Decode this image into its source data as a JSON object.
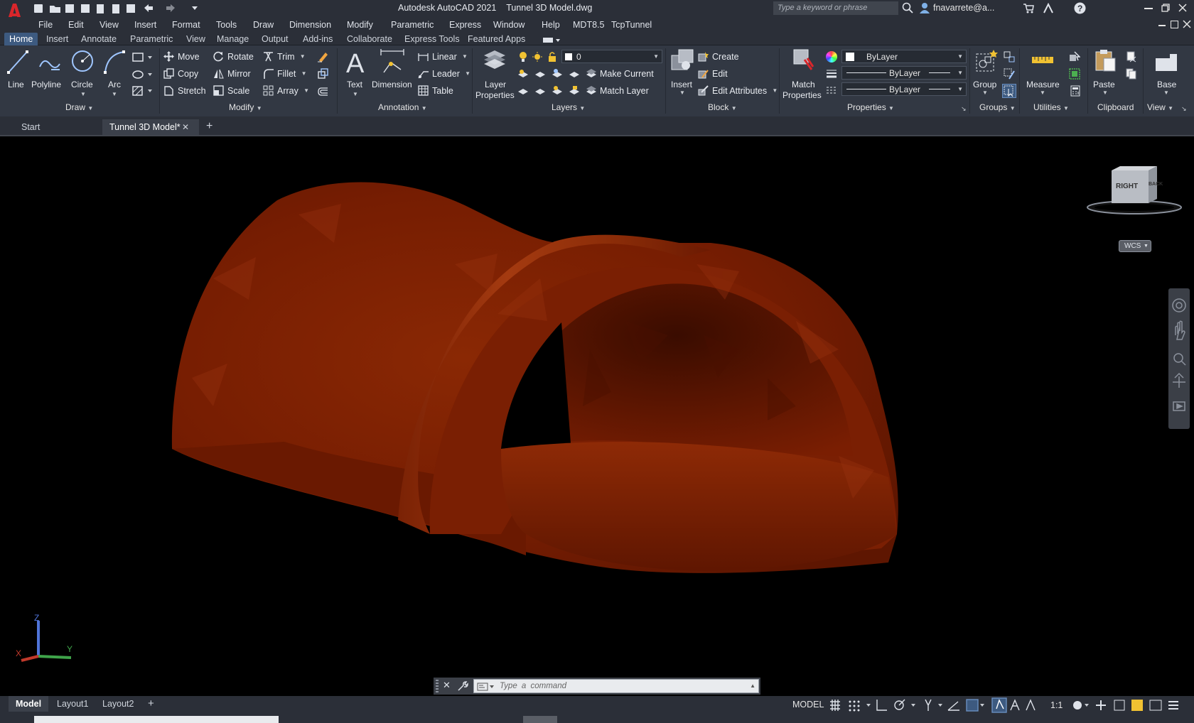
{
  "title": {
    "app": "Autodesk AutoCAD 2021",
    "file": "Tunnel 3D Model.dwg",
    "search_placeholder": "Type a keyword or phrase",
    "user": "fnavarrete@a..."
  },
  "menu": [
    "File",
    "Edit",
    "View",
    "Insert",
    "Format",
    "Tools",
    "Draw",
    "Dimension",
    "Modify",
    "Parametric",
    "Express",
    "Window",
    "Help",
    "MDT8.5",
    "TcpTunnel"
  ],
  "ribbon_tabs": [
    "Home",
    "Insert",
    "Annotate",
    "Parametric",
    "View",
    "Manage",
    "Output",
    "Add-ins",
    "Collaborate",
    "Express Tools",
    "Featured Apps"
  ],
  "draw": {
    "line": "Line",
    "polyline": "Polyline",
    "circle": "Circle",
    "arc": "Arc",
    "panel": "Draw"
  },
  "modify": {
    "move": "Move",
    "rotate": "Rotate",
    "trim": "Trim",
    "copy": "Copy",
    "mirror": "Mirror",
    "fillet": "Fillet",
    "stretch": "Stretch",
    "scale": "Scale",
    "array": "Array",
    "panel": "Modify"
  },
  "annotation": {
    "text": "Text",
    "dimension": "Dimension",
    "linear": "Linear",
    "leader": "Leader",
    "table": "Table",
    "panel": "Annotation"
  },
  "layers": {
    "layer_props_1": "Layer",
    "layer_props_2": "Properties",
    "current_layer": "0",
    "make_current": "Make Current",
    "match_layer": "Match Layer",
    "panel": "Layers"
  },
  "block": {
    "insert": "Insert",
    "create": "Create",
    "edit": "Edit",
    "edit_attributes": "Edit Attributes",
    "panel": "Block"
  },
  "properties": {
    "match_1": "Match",
    "match_2": "Properties",
    "color": "ByLayer",
    "linetype": "ByLayer",
    "lineweight": "ByLayer",
    "panel": "Properties"
  },
  "groups": {
    "group": "Group",
    "panel": "Groups"
  },
  "utilities": {
    "measure": "Measure",
    "panel": "Utilities"
  },
  "clipboard": {
    "paste": "Paste",
    "panel": "Clipboard"
  },
  "view": {
    "base": "Base",
    "panel": "View"
  },
  "doc_tabs": {
    "start": "Start",
    "active": "Tunnel 3D Model*"
  },
  "viewcube": {
    "right": "RIGHT",
    "back": "BACK",
    "wcs": "WCS"
  },
  "ucs": {
    "x": "X",
    "y": "Y",
    "z": "Z"
  },
  "command": {
    "placeholder": "Type a command"
  },
  "layouts": [
    "Model",
    "Layout1",
    "Layout2"
  ],
  "status": {
    "model": "MODEL",
    "scale": "1:1"
  },
  "colors": {
    "tunnel": "#7a1e02",
    "accent": "#3d5a80",
    "ribbon": "#323843"
  }
}
